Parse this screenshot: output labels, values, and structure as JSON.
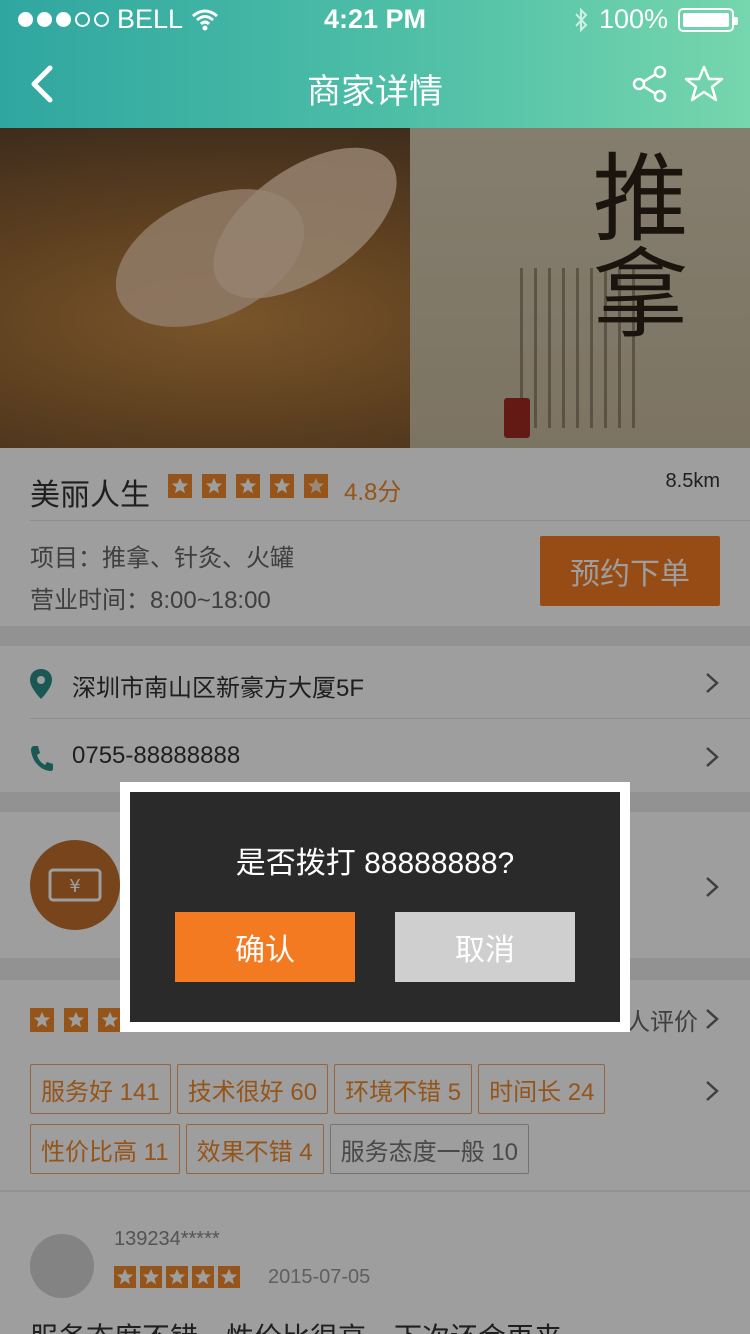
{
  "status_bar": {
    "carrier": "BELL",
    "time": "4:21 PM",
    "battery": "100%",
    "signal_dots_full": 3,
    "signal_dots_total": 5
  },
  "nav": {
    "title": "商家详情"
  },
  "shop": {
    "name": "美丽人生",
    "rating": 4.8,
    "rating_text": "4.8分",
    "distance": "8.5km",
    "project": "项目：推拿、针灸、火罐",
    "hours": "营业时间：8:00~18:00",
    "book_label": "预约下单"
  },
  "contact": {
    "address": "深圳市南山区新豪方大厦5F",
    "phone": "0755-88888888"
  },
  "reviews": {
    "count_text": "人评价",
    "tags": [
      {
        "label": "服务好 141",
        "style": "orange"
      },
      {
        "label": "技术很好 60",
        "style": "orange"
      },
      {
        "label": "环境不错 5",
        "style": "orange"
      },
      {
        "label": "时间长 24",
        "style": "orange"
      },
      {
        "label": "性价比高 11",
        "style": "orange"
      },
      {
        "label": "效果不错 4",
        "style": "orange"
      },
      {
        "label": "服务态度一般 10",
        "style": "gray"
      }
    ]
  },
  "comment": {
    "user": "139234*****",
    "date": "2015-07-05",
    "text": "服务态度不错，性价比很高，下次还会再来"
  },
  "dialog": {
    "message": "是否拨打 88888888?",
    "confirm_label": "确认",
    "cancel_label": "取消"
  },
  "colors": {
    "accent": "#f47a22",
    "header_start": "#2fa6a0",
    "header_end": "#76d6ad",
    "teal_icon": "#2a8e8a"
  }
}
